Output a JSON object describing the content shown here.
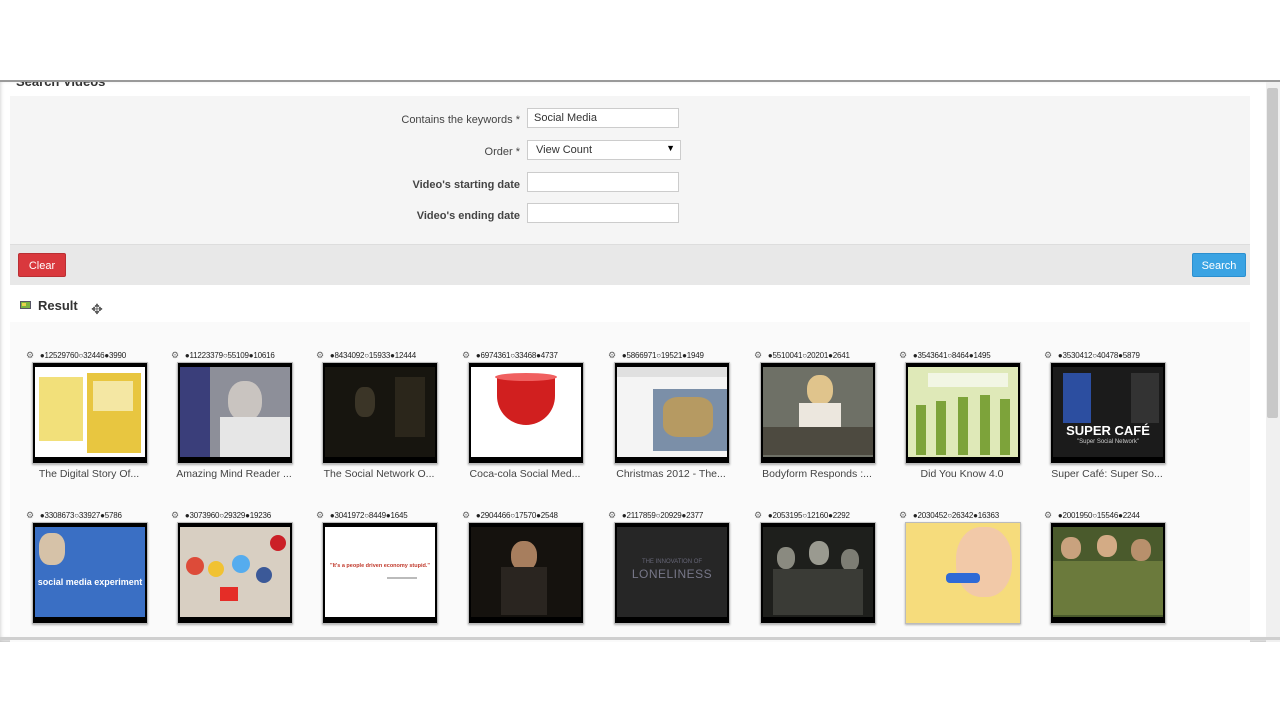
{
  "page": {
    "section_title": "Search Videos"
  },
  "form": {
    "keywords_label": "Contains the keywords *",
    "keywords_value": "Social Media",
    "order_label": "Order *",
    "order_value": "View Count",
    "start_label": "Video's starting date",
    "start_value": "",
    "end_label": "Video's ending date",
    "end_value": ""
  },
  "actions": {
    "clear_label": "Clear",
    "search_label": "Search"
  },
  "result": {
    "heading": "Result"
  },
  "videos": [
    {
      "stats": "●12529760○32446●3990",
      "title": "The Digital Story Of..."
    },
    {
      "stats": "●11223379○55109●10616",
      "title": "Amazing Mind Reader ..."
    },
    {
      "stats": "●8434092○15933●12444",
      "title": "The Social Network O..."
    },
    {
      "stats": "●6974361○33468●4737",
      "title": "Coca-cola Social Med..."
    },
    {
      "stats": "●5866971○19521●1949",
      "title": "Christmas 2012 - The..."
    },
    {
      "stats": "●5510041○20201●2641",
      "title": "Bodyform Responds :..."
    },
    {
      "stats": "●3543641○8464●1495",
      "title": "Did You Know 4.0"
    },
    {
      "stats": "●3530412○40478●5879",
      "title": "Super Café: Super So..."
    },
    {
      "stats": "●3308673○33927●5786",
      "title": ""
    },
    {
      "stats": "●3073960○29329●19236",
      "title": ""
    },
    {
      "stats": "●3041972○8449●1645",
      "title": ""
    },
    {
      "stats": "●2904466○17570●2548",
      "title": ""
    },
    {
      "stats": "●2117859○20929●2377",
      "title": ""
    },
    {
      "stats": "●2053195○12160●2292",
      "title": ""
    },
    {
      "stats": "●2030452○26342●16363",
      "title": ""
    },
    {
      "stats": "●2001950○15546●2244",
      "title": ""
    }
  ],
  "thumb_text": {
    "super_cafe": "SUPER CAFÉ",
    "super_cafe_sub": "\"Super Social Network\"",
    "social_experiment": "social media experiment",
    "people_driven": "\"It's a people driven economy stupid.\"",
    "loneliness_top": "THE INNOVATION OF",
    "loneliness": "LONELINESS"
  }
}
